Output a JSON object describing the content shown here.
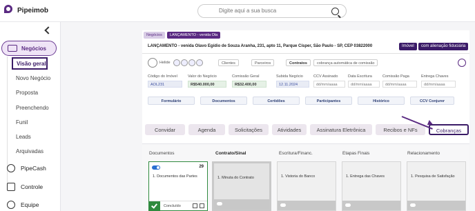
{
  "app": {
    "name": "Pipeimob"
  },
  "search": {
    "placeholder": "Digite aqui a sua busca"
  },
  "sidebar": {
    "main": "Negócios",
    "sub": [
      "Visão geral",
      "Novo Negócio",
      "Proposta",
      "Preenchendo",
      "Funil",
      "Leads",
      "Arquivadas"
    ],
    "other": [
      "PipeCash",
      "Controle",
      "Equipe"
    ]
  },
  "deal": {
    "breadcrumb": [
      "Negócios",
      "LANÇAMENTO - venida Ola"
    ],
    "title": "LANÇAMENTO - venida Olavo Egídio de Souza Aranha, 231, apto 11, Parque Císper, São Paulo - SP, CEP 03822000",
    "tags": [
      "Imóvel",
      "com alienação fiduciária"
    ],
    "user": "Helide",
    "selects": [
      "Clientes",
      "Parceiros",
      "Contratos"
    ],
    "auto_charge": "cobrança automática de comissão",
    "fields": [
      {
        "label": "Código do Imóvel",
        "value": "AOL231"
      },
      {
        "label": "Valor do Negócio",
        "value": "R$540.000,00"
      },
      {
        "label": "Comissão Geral",
        "value": "R$32.400,00"
      },
      {
        "label": "Subida Negócio",
        "value": "12.11.2024"
      },
      {
        "label": "CCV Assinado",
        "value": "dd/mm/aaaa"
      },
      {
        "label": "Data Escritura",
        "value": "dd/mm/aaaa"
      },
      {
        "label": "Comissão Paga",
        "value": "dd/mm/aaaa"
      },
      {
        "label": "Entrega Chaves",
        "value": "dd/mm/aaaa"
      }
    ],
    "actions": [
      "Formulário",
      "Documentos",
      "Certidões",
      "Participantes",
      "Histórico",
      "CCV Conjurer"
    ]
  },
  "tabs": [
    "Convidar",
    "Agenda",
    "Solicitações",
    "Atividades",
    "Assinatura Eletrônica",
    "Recibos e NFs",
    "Cobranças"
  ],
  "pipeline": {
    "stages": [
      "Documentos",
      "Contrato/Sinal",
      "Escritura/Financ.",
      "Etapas Finais",
      "Relacionamento"
    ],
    "cards": [
      {
        "title": "1. Documentos das Partes",
        "count": "29",
        "status": "Concluído"
      },
      {
        "title": "1. Minuta do Contrato"
      },
      {
        "title": "1. Vistoria do Banco"
      },
      {
        "title": "1. Entrega das Chaves"
      },
      {
        "title": "1. Pesquisa de Satisfação"
      }
    ]
  }
}
